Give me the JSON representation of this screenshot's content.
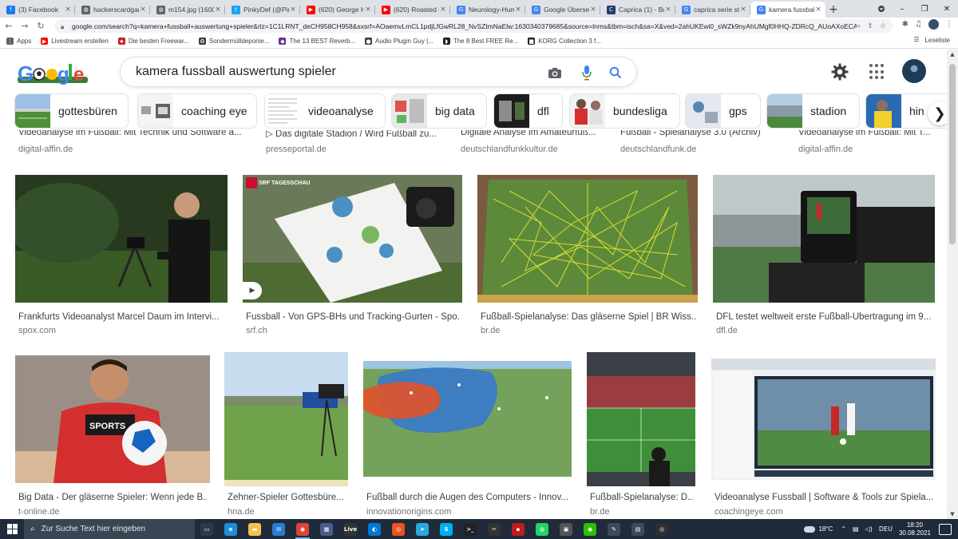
{
  "browser": {
    "tabs": [
      {
        "title": "(3) Facebook",
        "icon": "facebook-icon",
        "color": "#1877f2",
        "glyph": "f"
      },
      {
        "title": "hackerscardgam",
        "icon": "globe-icon",
        "color": "#5f6368",
        "glyph": "◍"
      },
      {
        "title": "m154.jpg (1600",
        "icon": "globe-icon",
        "color": "#5f6368",
        "glyph": "◍"
      },
      {
        "title": "PinkyDef (@Pin",
        "icon": "twitter-icon",
        "color": "#1da1f2",
        "glyph": "t"
      },
      {
        "title": "(620) George H",
        "icon": "youtube-icon",
        "color": "#ff0000",
        "glyph": "▶"
      },
      {
        "title": "(620) Roasted C",
        "icon": "youtube-icon",
        "color": "#ff0000",
        "glyph": "▶"
      },
      {
        "title": "Neurology-Hum",
        "icon": "google-icon",
        "color": "#4285f4",
        "glyph": "G"
      },
      {
        "title": "Google Übersetz",
        "icon": "translate-icon",
        "color": "#4285f4",
        "glyph": "G"
      },
      {
        "title": "Caprica (1) - Bu",
        "icon": "bookmark-icon",
        "color": "#1f3c6e",
        "glyph": "C"
      },
      {
        "title": "caprica serie sta",
        "icon": "google-icon",
        "color": "#4285f4",
        "glyph": "G"
      },
      {
        "title": "kamera fussball",
        "icon": "google-icon",
        "color": "#4285f4",
        "glyph": "G",
        "active": true
      }
    ],
    "url": "google.com/search?q=kamera+fussball+auswertung+spieler&rlz=1C1LRNT_deCH958CH958&sxsrf=AOaemvLmCL1pdjLfGwRL28_NvSZtmNaElw:1630340379685&source=lnms&tbm=isch&sa=X&ved=2ahUKEwi0_sWZk9nyAhUMgf0HHQ-ZDRcQ_AUoAXoECA...",
    "bookmarks": [
      {
        "label": "Apps",
        "icon": "apps-grid-icon",
        "color": "#5f6368",
        "glyph": "⋮"
      },
      {
        "label": "Livestream erstellen",
        "icon": "youtube-icon",
        "color": "#ff0000",
        "glyph": "▶"
      },
      {
        "label": "Die besten Freewar...",
        "icon": "star-icon",
        "color": "#c5221f",
        "glyph": "★"
      },
      {
        "label": "Sondermülldeponie...",
        "icon": "recycle-icon",
        "color": "#3c4043",
        "glyph": "♻"
      },
      {
        "label": "The 13 BEST Reverb...",
        "icon": "site-icon",
        "color": "#6b2f8f",
        "glyph": "◆"
      },
      {
        "label": "Audio Plugin Guy |...",
        "icon": "site-icon",
        "color": "#3c4043",
        "glyph": "●"
      },
      {
        "label": "The 8 Best FREE Re...",
        "icon": "site-icon",
        "color": "#202124",
        "glyph": "◗"
      },
      {
        "label": "KORG Collection 3 f...",
        "icon": "site-icon",
        "color": "#202124",
        "glyph": "■"
      }
    ],
    "reading_list": "Leseliste"
  },
  "google": {
    "query": "kamera fussball auswertung spieler",
    "chips": [
      "gottesbüren",
      "coaching eye",
      "videoanalyse",
      "big data",
      "dfl",
      "bundesliga",
      "gps",
      "stadion",
      "hin"
    ]
  },
  "results": {
    "top_partial": [
      {
        "title": "Videoanalyse im Fußball: Mit Technik und Software a...",
        "source": "digital-affin.de"
      },
      {
        "title": "▷ Das digitale Stadion / Wird Fußball zu...",
        "source": "presseportal.de"
      },
      {
        "title": "Digitale Analyse im Amateurfuß...",
        "source": "deutschlandfunkkultur.de"
      },
      {
        "title": "Fußball - Spielanalyse 3.0 (Archiv)",
        "source": "deutschlandfunk.de"
      },
      {
        "title": "Videoanalyse im Fußball: Mit T...",
        "source": "digital-affin.de"
      }
    ],
    "row1": [
      {
        "title": "Frankfurts Videoanalyst Marcel Daum im Intervi...",
        "source": "spox.com"
      },
      {
        "title": "Fussball - Von GPS-BHs und Tracking-Gurten - Spo...",
        "source": "srf.ch",
        "watermark": "SRF TAGESSCHAU"
      },
      {
        "title": "Fußball-Spielanalyse: Das gläserne Spiel | BR Wiss...",
        "source": "br.de"
      },
      {
        "title": "DFL testet weltweit erste Fußball-Übertragung im 9...",
        "source": "dfl.de"
      }
    ],
    "row2": [
      {
        "title": "Big Data - Der gläserne Spieler: Wenn jede B...",
        "source": "t-online.de",
        "shirt": "SPORTS"
      },
      {
        "title": "Zehner-Spieler Gottesbüre...",
        "source": "hna.de"
      },
      {
        "title": "Fußball durch die Augen des Computers - Innov...",
        "source": "innovationorigins.com"
      },
      {
        "title": "Fußball-Spielanalyse: D...",
        "source": "br.de"
      },
      {
        "title": "Videoanalyse Fussball | Software & Tools zur Spiela...",
        "source": "coachingeye.com"
      }
    ]
  },
  "taskbar": {
    "search_placeholder": "Zur Suche Text hier eingeben",
    "apps": [
      {
        "name": "task-view",
        "color": "#2b3a4a",
        "glyph": "▭"
      },
      {
        "name": "edge",
        "color": "#1c8fd8",
        "glyph": "e"
      },
      {
        "name": "file-explorer",
        "color": "#f2c14e",
        "glyph": "▬"
      },
      {
        "name": "mail",
        "color": "#2a7bd4",
        "glyph": "✉"
      },
      {
        "name": "chrome",
        "color": "#db4437",
        "glyph": "◉",
        "active": true
      },
      {
        "name": "photos",
        "color": "#4a5b8c",
        "glyph": "▦"
      },
      {
        "name": "live",
        "color": "#333",
        "glyph": "Live"
      },
      {
        "name": "media",
        "color": "#0078d4",
        "glyph": "◐"
      },
      {
        "name": "ubuntu",
        "color": "#e95420",
        "glyph": "◎"
      },
      {
        "name": "telegram",
        "color": "#2ca5e0",
        "glyph": "➤"
      },
      {
        "name": "skype",
        "color": "#00aff0",
        "glyph": "S"
      },
      {
        "name": "terminal",
        "color": "#222",
        "glyph": ">_"
      },
      {
        "name": "tool",
        "color": "#333",
        "glyph": "✂"
      },
      {
        "name": "app-red",
        "color": "#c21b1b",
        "glyph": "▪"
      },
      {
        "name": "whatsapp",
        "color": "#25d366",
        "glyph": "◍"
      },
      {
        "name": "film",
        "color": "#555",
        "glyph": "▣"
      },
      {
        "name": "wechat",
        "color": "#2dc100",
        "glyph": "◉"
      },
      {
        "name": "pen",
        "color": "#3c4a5c",
        "glyph": "✎"
      },
      {
        "name": "folder",
        "color": "#3c4a5c",
        "glyph": "▤"
      },
      {
        "name": "obs",
        "color": "#302e31",
        "glyph": "◎"
      }
    ],
    "weather": "18°C",
    "language": "DEU",
    "time": "18:20",
    "date": "30.08.2021"
  }
}
